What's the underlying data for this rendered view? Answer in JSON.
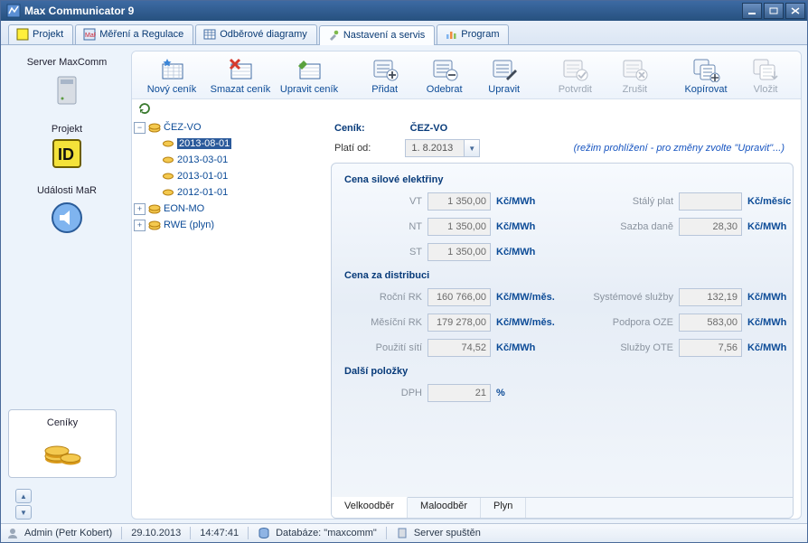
{
  "window": {
    "title": "Max Communicator 9"
  },
  "tabs": [
    "Projekt",
    "Měření a Regulace",
    "Odběrové diagramy",
    "Nastavení a servis",
    "Program"
  ],
  "rail": [
    {
      "label": "Server MaxComm"
    },
    {
      "label": "Projekt"
    },
    {
      "label": "Události MaR"
    },
    {
      "label": "Ceníky"
    }
  ],
  "toolbar": [
    "Nový ceník",
    "Smazat ceník",
    "Upravit ceník",
    "Přidat",
    "Odebrat",
    "Upravit",
    "Potvrdit",
    "Zrušit",
    "Kopírovat",
    "Vložit"
  ],
  "tree": [
    {
      "name": "ČEZ-VO",
      "expanded": true,
      "children": [
        "2013-08-01",
        "2013-03-01",
        "2013-01-01",
        "2012-01-01"
      ]
    },
    {
      "name": "EON-MO",
      "expanded": false
    },
    {
      "name": "RWE (plyn)",
      "expanded": false
    }
  ],
  "form": {
    "cenik_label": "Ceník:",
    "cenik_value": "ČEZ-VO",
    "plati_label": "Platí od:",
    "plati_value": "1.  8.2013",
    "mode_hint": "(režim prohlížení - pro změny zvolte \"Upravit\"...)",
    "sections": [
      {
        "title": "Cena silové elektřiny",
        "rows": [
          {
            "label": "VT",
            "value": "1 350,00",
            "unit": "Kč/MWh",
            "label2": "Stálý plat",
            "value2": "",
            "unit2": "Kč/měsíc"
          },
          {
            "label": "NT",
            "value": "1 350,00",
            "unit": "Kč/MWh",
            "label2": "Sazba daně",
            "value2": "28,30",
            "unit2": "Kč/MWh"
          },
          {
            "label": "ST",
            "value": "1 350,00",
            "unit": "Kč/MWh"
          }
        ]
      },
      {
        "title": "Cena za distribuci",
        "rows": [
          {
            "label": "Roční RK",
            "value": "160 766,00",
            "unit": "Kč/MW/měs.",
            "label2": "Systémové služby",
            "value2": "132,19",
            "unit2": "Kč/MWh"
          },
          {
            "label": "Měsíční RK",
            "value": "179 278,00",
            "unit": "Kč/MW/měs.",
            "label2": "Podpora OZE",
            "value2": "583,00",
            "unit2": "Kč/MWh"
          },
          {
            "label": "Použití sítí",
            "value": "74,52",
            "unit": "Kč/MWh",
            "label2": "Služby OTE",
            "value2": "7,56",
            "unit2": "Kč/MWh"
          }
        ]
      },
      {
        "title": "Další položky",
        "rows": [
          {
            "label": "DPH",
            "value": "21",
            "unit": "%"
          }
        ]
      }
    ],
    "subtabs": [
      "Velkoodběr",
      "Maloodběr",
      "Plyn"
    ]
  },
  "status": {
    "user": "Admin (Petr Kobert)",
    "date": "29.10.2013",
    "time": "14:47:41",
    "db": "Databáze: \"maxcomm\"",
    "server": "Server spuštěn"
  }
}
